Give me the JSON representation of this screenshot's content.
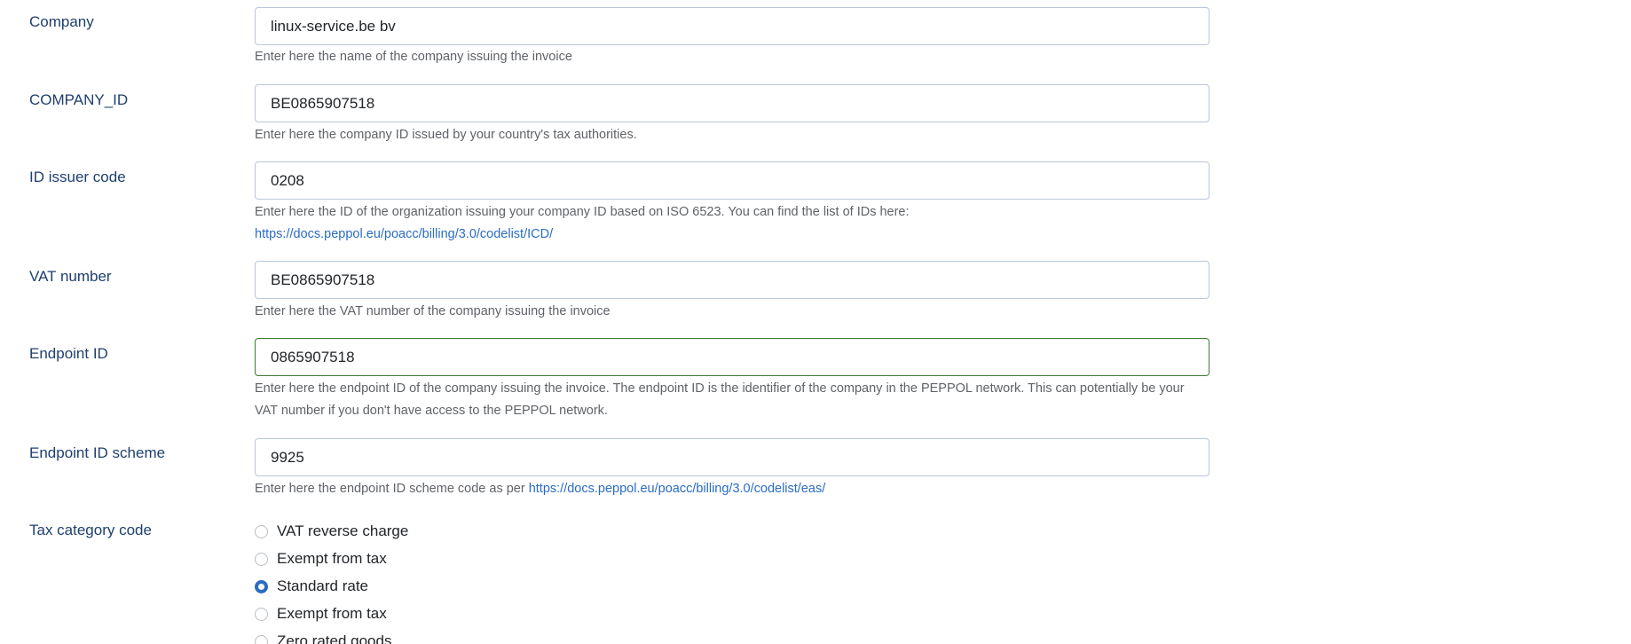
{
  "fields": [
    {
      "label": "Company",
      "value": "linux-service.be bv",
      "help": "Enter here the name of the company issuing the invoice"
    },
    {
      "label": "COMPANY_ID",
      "value": "BE0865907518",
      "help": "Enter here the company ID issued by your country's tax authorities."
    },
    {
      "label": "ID issuer code",
      "value": "0208",
      "help_text": "Enter here the ID of the organization issuing your company ID based on ISO 6523. You can find the list of IDs here: ",
      "help_link": "https://docs.peppol.eu/poacc/billing/3.0/codelist/ICD/"
    },
    {
      "label": "VAT number",
      "value": "BE0865907518",
      "help": "Enter here the VAT number of the company issuing the invoice"
    },
    {
      "label": "Endpoint ID",
      "value": "0865907518",
      "help": "Enter here the endpoint ID of the company issuing the invoice. The endpoint ID is the identifier of the company in the PEPPOL network. This can potentially be your VAT number if you don't have access to the PEPPOL network."
    },
    {
      "label": "Endpoint ID scheme",
      "value": "9925",
      "help_text": "Enter here the endpoint ID scheme code as per ",
      "help_link": "https://docs.peppol.eu/poacc/billing/3.0/codelist/eas/"
    }
  ],
  "tax_category": {
    "label": "Tax category code",
    "options": [
      {
        "label": "VAT reverse charge",
        "checked": false
      },
      {
        "label": "Exempt from tax",
        "checked": false
      },
      {
        "label": "Standard rate",
        "checked": true
      },
      {
        "label": "Exempt from tax",
        "checked": false
      },
      {
        "label": "Zero rated goods",
        "checked": false
      }
    ]
  },
  "colors": {
    "label": "#1f3f6e",
    "link": "#2a6cc4",
    "help": "#5f6368",
    "input_border": "#b9c7d9",
    "valid_border": "#3f7a34"
  }
}
